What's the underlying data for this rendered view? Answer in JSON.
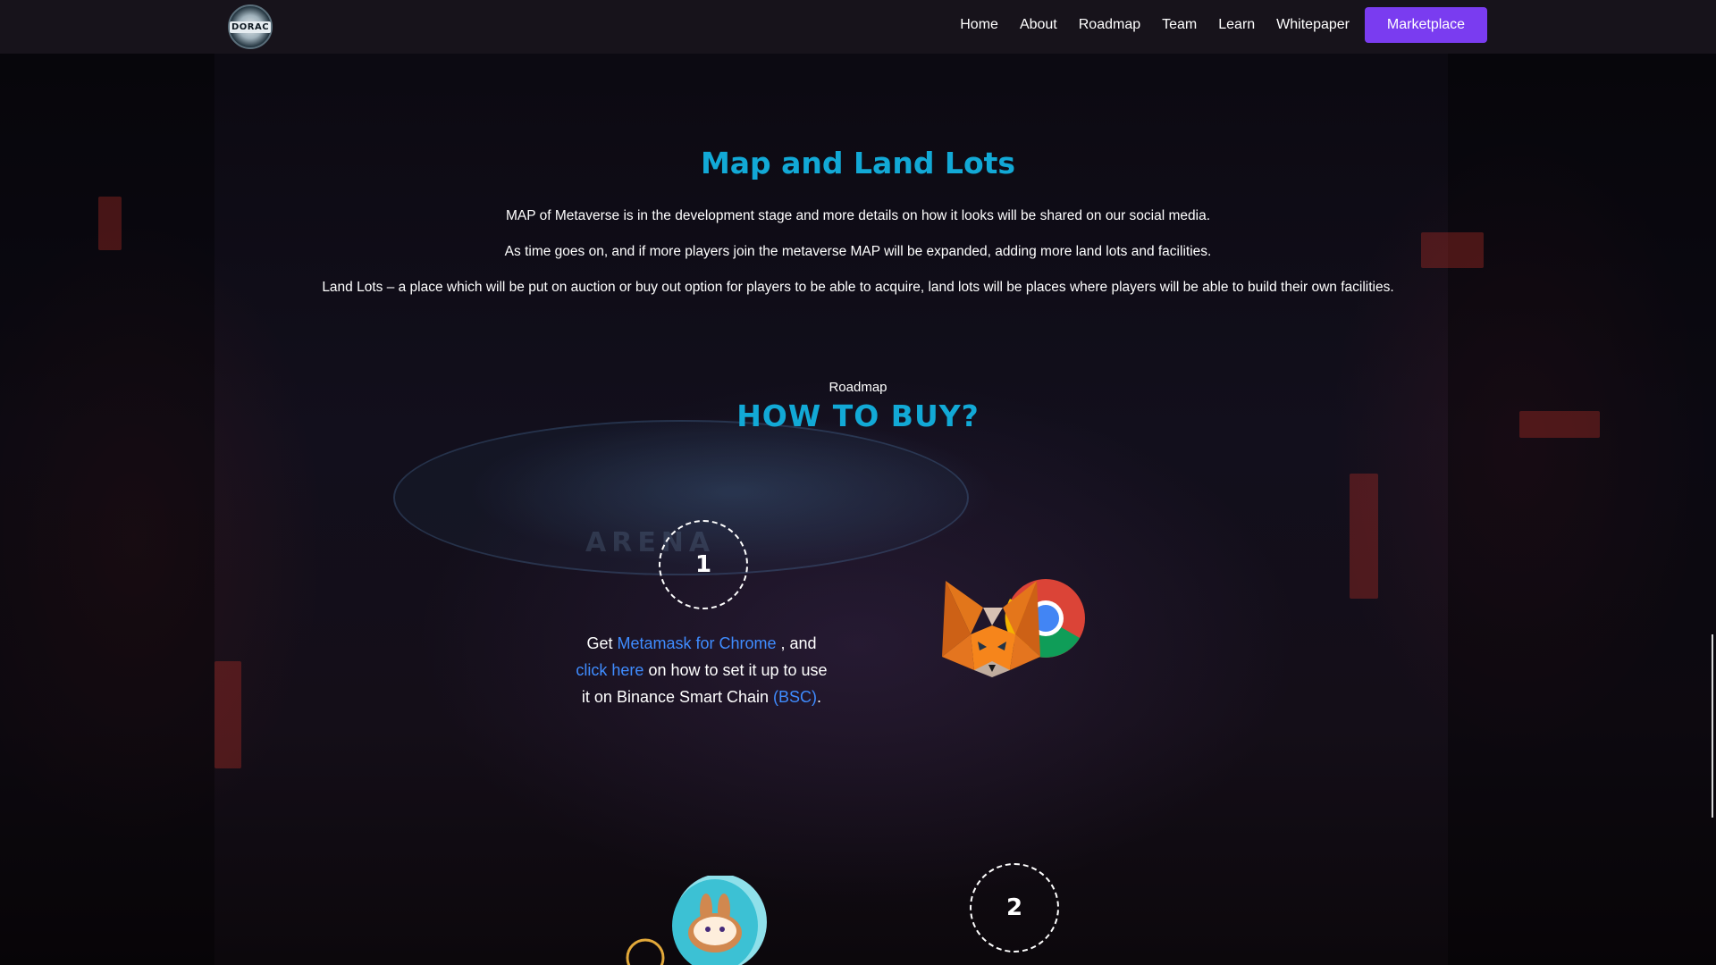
{
  "header": {
    "logo_text": "DORAC",
    "nav": [
      {
        "label": "Home"
      },
      {
        "label": "About"
      },
      {
        "label": "Roadmap"
      },
      {
        "label": "Team"
      },
      {
        "label": "Learn"
      },
      {
        "label": "Whitepaper"
      }
    ],
    "marketplace_label": "Marketplace"
  },
  "map_section": {
    "title": "Map and Land Lots",
    "paragraphs": [
      "MAP of Metaverse is in the development stage and more details on how it looks will be shared on our social media.",
      "As time goes on, and if more players join the metaverse MAP will be expanded, adding more land lots and facilities.",
      "Land Lots – a place which will be put on auction or buy out option for players to be able to acquire, land lots will be places where players will be able to build their own facilities."
    ]
  },
  "how_to_buy": {
    "eyebrow": "Roadmap",
    "title": "HOW TO BUY?",
    "background_sign": "ARENA",
    "steps": [
      {
        "number": "1",
        "text_get": "Get ",
        "link_metamask": "Metamask for Chrome",
        "text_and": " , and ",
        "link_click_here": "click here",
        "text_setup": " on how to set it up to use it on Binance Smart Chain ",
        "link_bsc": "(BSC)",
        "text_end": ".",
        "illustration": "metamask-chrome-icon"
      },
      {
        "number": "2",
        "illustration": "pancakeswap-coin-icon"
      }
    ]
  },
  "colors": {
    "accent_cyan": "#12a9d6",
    "button_purple": "#7a3cf0",
    "link_blue": "#3f8cff",
    "navbar_bg": "#17131b"
  }
}
